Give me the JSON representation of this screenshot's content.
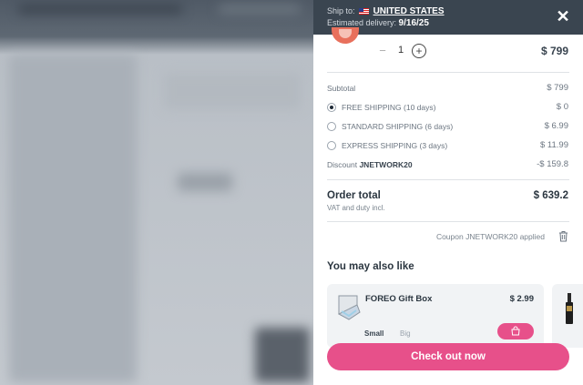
{
  "header": {
    "ship_to_label": "Ship to:",
    "ship_to_country": "UNITED STATES",
    "delivery_label": "Estimated delivery:",
    "delivery_date": "9/16/25",
    "flag_icon": "us-flag-icon",
    "close_icon": "close-icon",
    "close_glyph": "✕"
  },
  "cart_item": {
    "quantity": "1",
    "minus": "−",
    "plus": "+",
    "price": "$ 799"
  },
  "summary": {
    "subtotal_label": "Subtotal",
    "subtotal_value": "$ 799",
    "shipping_options": [
      {
        "label": "FREE SHIPPING (10 days)",
        "price": "$ 0",
        "selected": true
      },
      {
        "label": "STANDARD SHIPPING (6 days)",
        "price": "$ 6.99",
        "selected": false
      },
      {
        "label": "EXPRESS SHIPPING (3 days)",
        "price": "$ 11.99",
        "selected": false
      }
    ],
    "discount_label": "Discount",
    "discount_code": "JNETWORK20",
    "discount_value": "-$ 159.8",
    "order_total_label": "Order total",
    "order_total_value": "$ 639.2",
    "vat_note": "VAT and duty incl.",
    "coupon_text": "Coupon JNETWORK20 applied"
  },
  "upsell": {
    "title": "You may also like",
    "products": [
      {
        "name": "FOREO Gift Box",
        "price": "$ 2.99",
        "sizes": [
          "Small",
          "Big"
        ],
        "selected_size": "Small"
      }
    ]
  },
  "checkout_label": "Check out now",
  "colors": {
    "accent": "#e7508a",
    "header_bg": "#3a4550",
    "text_dark": "#2b3640"
  }
}
